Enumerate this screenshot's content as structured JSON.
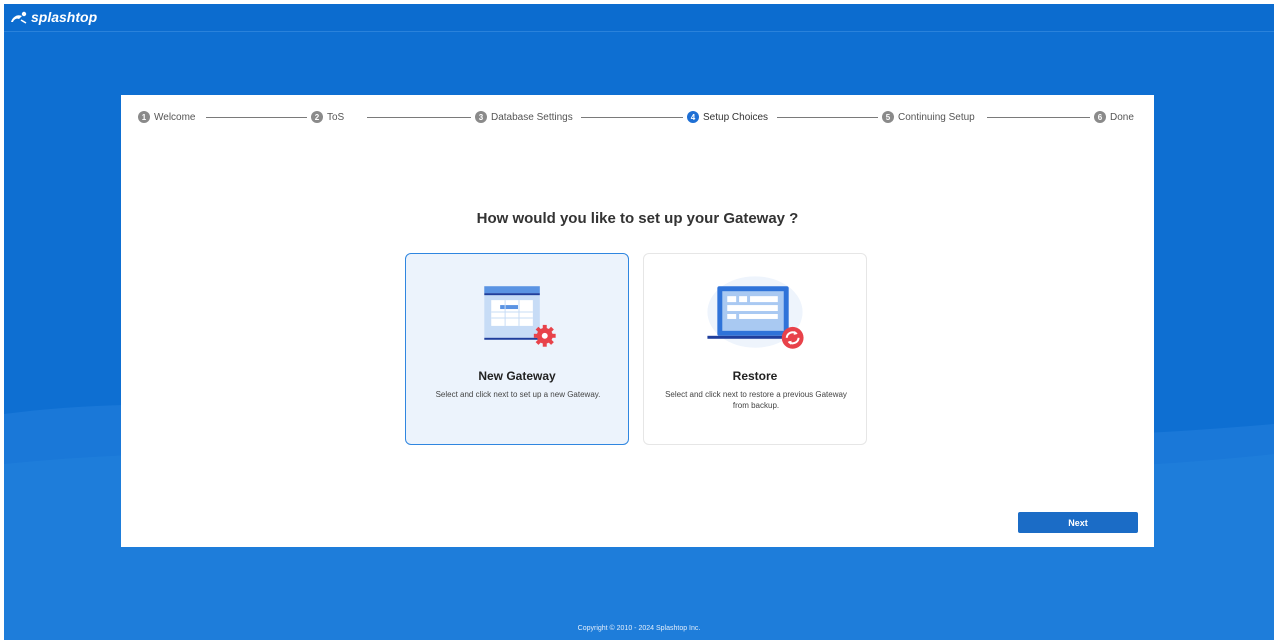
{
  "header": {
    "logo_text": "splashtop"
  },
  "steps": [
    {
      "num": "1",
      "label": "Welcome"
    },
    {
      "num": "2",
      "label": "ToS"
    },
    {
      "num": "3",
      "label": "Database Settings"
    },
    {
      "num": "4",
      "label": "Setup Choices"
    },
    {
      "num": "5",
      "label": "Continuing Setup"
    },
    {
      "num": "6",
      "label": "Done"
    }
  ],
  "active_step": 4,
  "question": "How would you like to set up your Gateway ?",
  "options": [
    {
      "title": "New Gateway",
      "description": "Select and click next to set up a new Gateway.",
      "icon": "new-gateway-illustration",
      "selected": true
    },
    {
      "title": "Restore",
      "description": "Select and click next to restore a previous Gateway from backup.",
      "icon": "restore-illustration",
      "selected": false
    }
  ],
  "next_label": "Next",
  "footer": {
    "copyright": "Copyright © 2010 - 2024 Splashtop Inc."
  },
  "colors": {
    "background": "#0e6fd2",
    "accent": "#1e6fd4",
    "button": "#1b6cc6",
    "badge_red": "#e8424a"
  }
}
